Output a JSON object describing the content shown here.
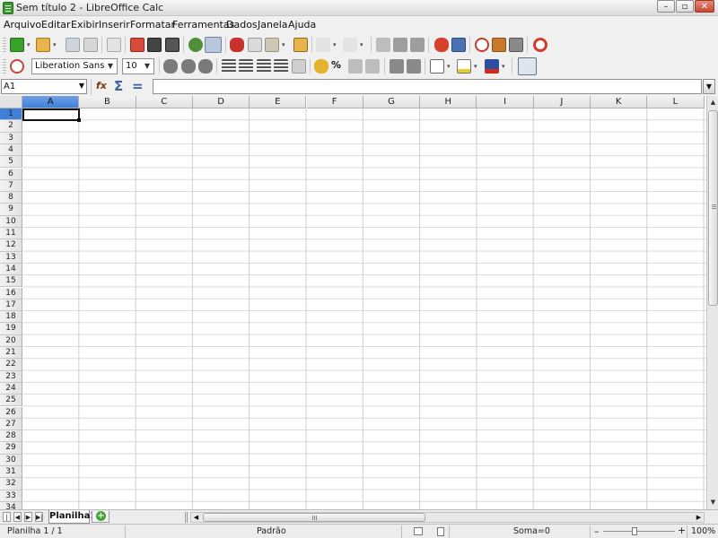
{
  "window": {
    "title": "Sem título 2 - LibreOffice Calc"
  },
  "menu": [
    "Arquivo",
    "Editar",
    "Exibir",
    "Inserir",
    "Formatar",
    "Ferramentas",
    "Dados",
    "Janela",
    "Ajuda"
  ],
  "format": {
    "font_name": "Liberation Sans",
    "font_size": "10"
  },
  "formula": {
    "name_box": "A1",
    "content": ""
  },
  "columns": [
    "A",
    "B",
    "C",
    "D",
    "E",
    "F",
    "G",
    "H",
    "I",
    "J",
    "K",
    "L"
  ],
  "rows": [
    "1",
    "2",
    "3",
    "4",
    "5",
    "6",
    "7",
    "8",
    "9",
    "10",
    "11",
    "12",
    "13",
    "14",
    "15",
    "16",
    "17",
    "18",
    "19",
    "20",
    "21",
    "22",
    "23",
    "24",
    "25",
    "26",
    "27",
    "28",
    "29",
    "30",
    "31",
    "32",
    "33",
    "34"
  ],
  "selection": {
    "column": "A",
    "row": "1"
  },
  "sheets": {
    "tabs": [
      "Planilha1"
    ],
    "active": "Planilha1"
  },
  "status": {
    "sheet_position": "Planilha 1 / 1",
    "page_style": "Padrão",
    "sum": "Soma=0",
    "zoom": "100%",
    "zoom_value": 100
  },
  "colors": {
    "selection_header": "#3f7fd8",
    "grid_line": "#cfcfcf",
    "header_bg": "#e8e8e8"
  }
}
